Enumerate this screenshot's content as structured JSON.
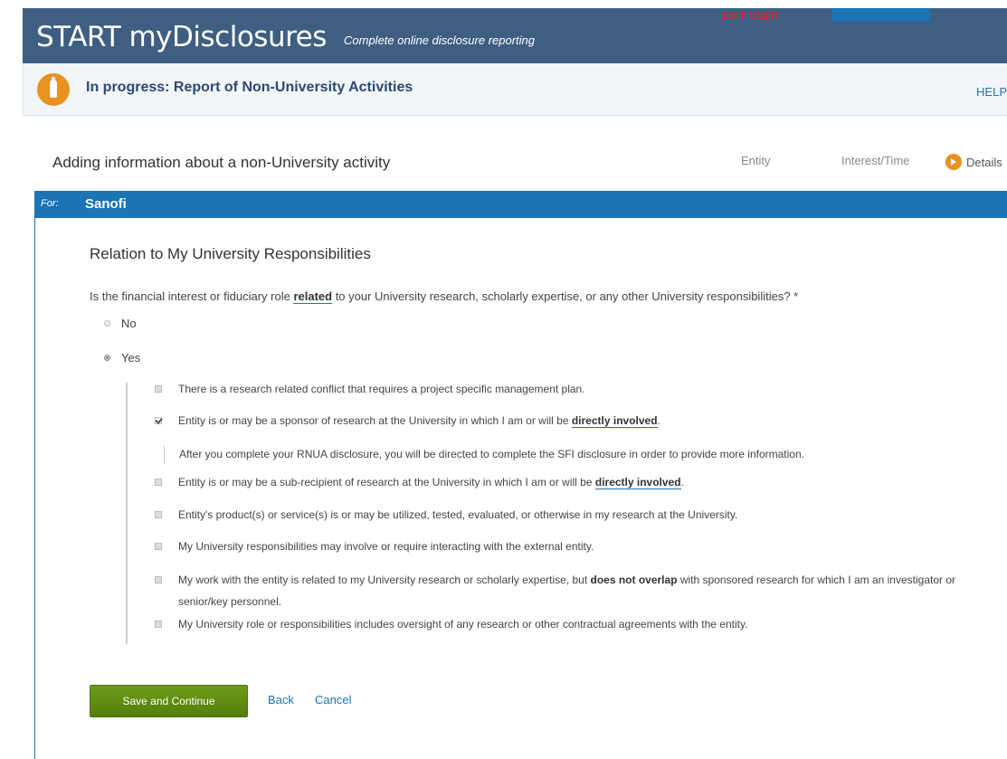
{
  "header": {
    "title": "START myDisclosures",
    "subtitle": "Complete online disclosure reporting",
    "exit_user": "EXIT USER",
    "accent": "#3f5f82"
  },
  "status": {
    "text": "In progress: Report of Non-University Activities",
    "help": "HELP"
  },
  "steps": {
    "heading": "Adding information about a non-University activity",
    "items": [
      "Entity",
      "Interest/Time",
      "Details"
    ],
    "current": "Details"
  },
  "for_bar": {
    "label": "For:",
    "value": "Sanofi",
    "color": "#1a74b5"
  },
  "section": {
    "title": "Relation to My University Responsibilities",
    "question_pre": "Is the financial interest or fiduciary role ",
    "question_bold": "related",
    "question_post": " to your University research, scholarly expertise, or any other University responsibilities? *",
    "radios": [
      {
        "label": "No",
        "checked": false
      },
      {
        "label": "Yes",
        "checked": true
      }
    ],
    "options": [
      {
        "text": "There is a research related conflict that requires a project specific management plan.",
        "checked": false
      },
      {
        "text_pre": "Entity is or may be a sponsor of research at the University in which I am or will be ",
        "text_bold": "directly involved",
        "text_post": ".",
        "checked": true
      },
      {
        "text_pre": "Entity is or may be a sub-recipient of research at the University in which I am or will be ",
        "text_bold": "directly involved",
        "text_post": ".",
        "checked": false
      },
      {
        "text": "Entity's product(s) or service(s) is or may be utilized, tested, evaluated, or otherwise in my research at the University.",
        "checked": false
      },
      {
        "text": "My University responsibilities may involve or require interacting with the external entity.",
        "checked": false
      },
      {
        "text_pre": "My work with the entity is related to my University research or scholarly expertise, but ",
        "text_bold": "does not overlap",
        "text_post": " with sponsored research for which I am an investigator or senior/key personnel.",
        "checked": false
      },
      {
        "text": "My University role or responsibilities includes oversight of any research or other contractual agreements with the entity.",
        "checked": false
      }
    ],
    "note": "After you complete your RNUA disclosure, you will be directed to complete the SFI disclosure in order to provide more information."
  },
  "actions": {
    "save": "Save and Continue",
    "back": "Back",
    "cancel": "Cancel",
    "save_color": "#5f8c10"
  }
}
